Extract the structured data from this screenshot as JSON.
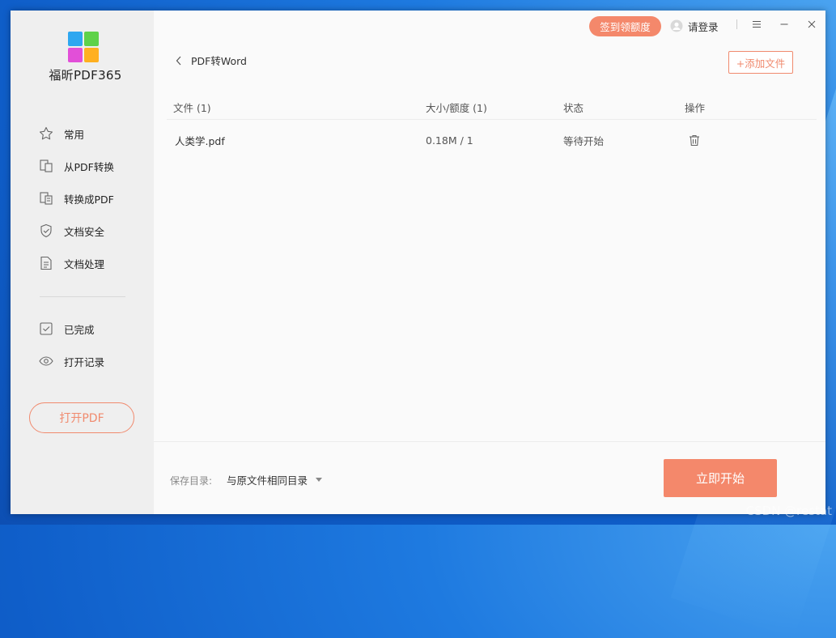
{
  "app": {
    "name": "福昕PDF365"
  },
  "sidebar": {
    "items": [
      {
        "label": "常用",
        "icon": "star-icon"
      },
      {
        "label": "从PDF转换",
        "icon": "from-pdf-icon"
      },
      {
        "label": "转换成PDF",
        "icon": "to-pdf-icon"
      },
      {
        "label": "文档安全",
        "icon": "shield-icon"
      },
      {
        "label": "文档处理",
        "icon": "document-icon"
      },
      {
        "label": "已完成",
        "icon": "checkbox-icon"
      },
      {
        "label": "打开记录",
        "icon": "eye-icon"
      }
    ],
    "open_pdf_label": "打开PDF"
  },
  "topbar": {
    "signin_badge": "签到领额度",
    "login_label": "请登录"
  },
  "main": {
    "breadcrumb": "PDF转Word",
    "add_file_label": "+添加文件",
    "table": {
      "headers": [
        "文件 (1)",
        "大小/额度 (1)",
        "状态",
        "操作"
      ],
      "rows": [
        {
          "file": "人类学.pdf",
          "size_quota": "0.18M / 1",
          "status": "等待开始"
        }
      ]
    },
    "save_dir_label": "保存目录:",
    "save_dir_value": "与原文件相同目录",
    "start_label": "立即开始"
  },
  "watermark": "CSDN @restat",
  "colors": {
    "accent": "#f4886b",
    "sidebar_bg": "#efefef",
    "content_bg": "#fafafa"
  }
}
